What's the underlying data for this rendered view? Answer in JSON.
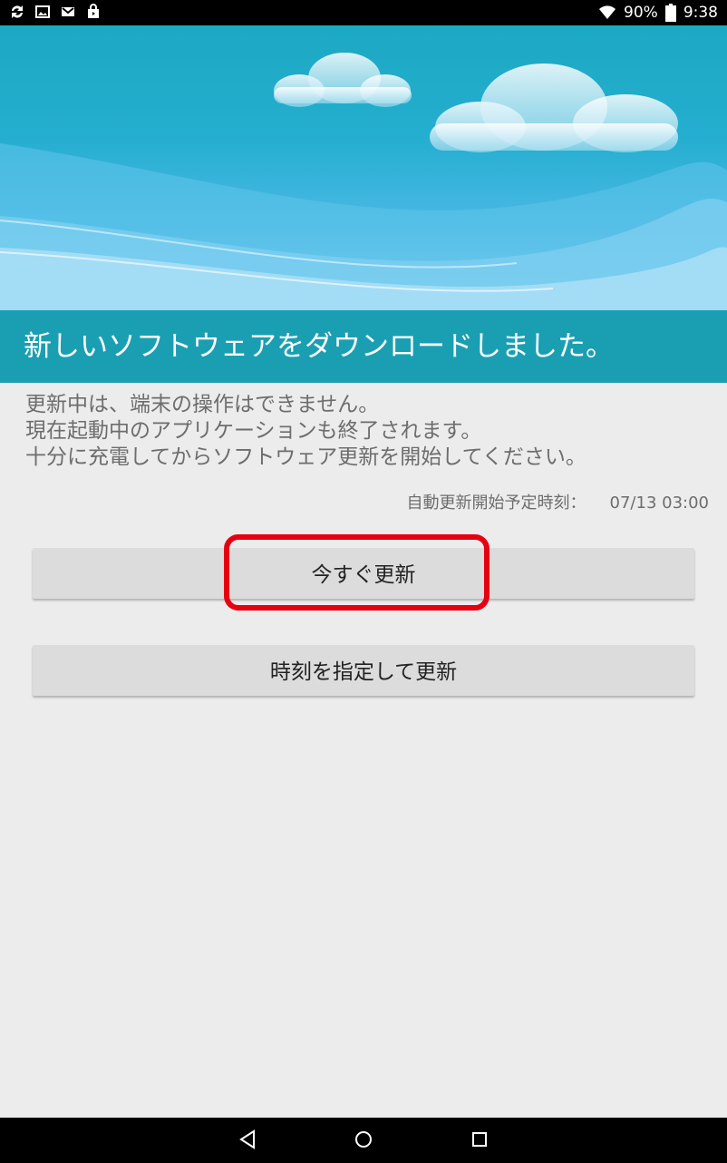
{
  "status_bar": {
    "battery": "90%",
    "time": "9:38"
  },
  "title": "新しいソフトウェアをダウンロードしました。",
  "message_lines": [
    "更新中は、端末の操作はできません。",
    "現在起動中のアプリケーションも終了されます。",
    "十分に充電してからソフトウェア更新を開始してください。"
  ],
  "schedule": {
    "label": "自動更新開始予定時刻：",
    "time": "07/13 03:00"
  },
  "buttons": {
    "update_now": "今すぐ更新",
    "update_scheduled": "時刻を指定して更新"
  },
  "colors": {
    "banner": "#1a9fb2",
    "highlight": "#e60012"
  },
  "nav_icons": [
    "back-icon",
    "home-icon",
    "recents-icon"
  ]
}
